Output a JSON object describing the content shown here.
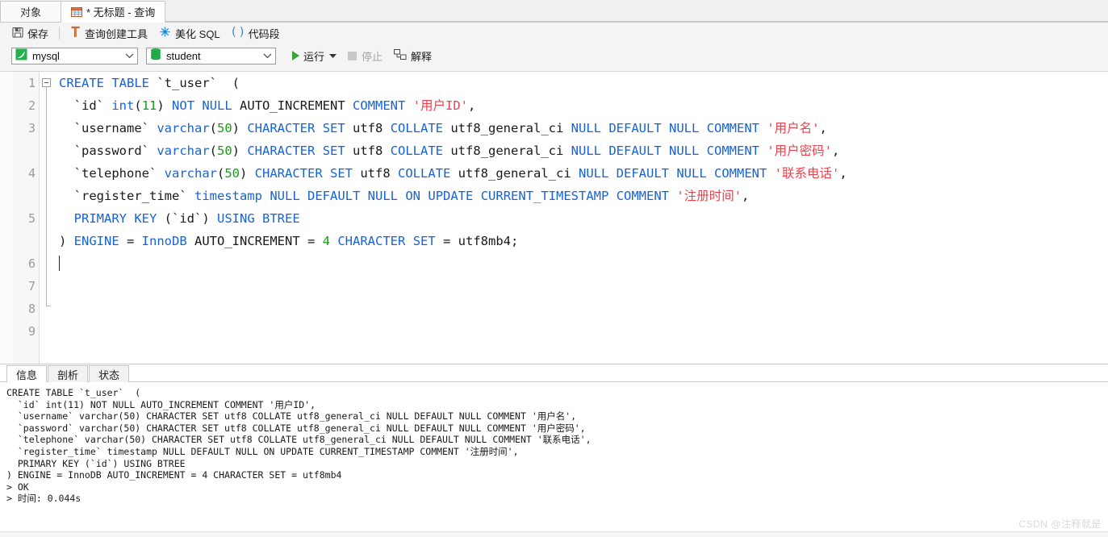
{
  "tabs": {
    "objects_label": "对象",
    "query_label": "* 无标题 - 查询",
    "query_icon": "grid-table-icon"
  },
  "toolbar": {
    "save_label": "保存",
    "save_icon": "floppy-disk-icon",
    "query_builder_label": "查询创建工具",
    "query_builder_icon": "builder-tool-icon",
    "beautify_label": "美化 SQL",
    "beautify_icon": "sparkle-wand-icon",
    "snippet_label": "代码段",
    "snippet_icon": "parentheses-icon"
  },
  "selectors": {
    "connection_value": "mysql",
    "connection_icon": "mysql-dolphin-icon",
    "database_value": "student",
    "database_icon": "database-stack-icon",
    "caret_icon": "chevron-down-icon",
    "run_label": "运行",
    "run_icon": "play-triangle-icon",
    "run_caret_icon": "chevron-down-icon",
    "stop_label": "停止",
    "stop_icon": "stop-square-icon",
    "explain_label": "解释",
    "explain_icon": "explain-plan-icon"
  },
  "editor": {
    "line_numbers": [
      "1",
      "2",
      "3",
      "4",
      "5",
      "6",
      "7",
      "8",
      "9"
    ],
    "lines": [
      {
        "n": "1",
        "tokens": [
          {
            "t": "CREATE",
            "c": "kw"
          },
          {
            "t": " ",
            "c": "plain"
          },
          {
            "t": "TABLE",
            "c": "kw"
          },
          {
            "t": " `t_user`  (",
            "c": "plain"
          }
        ]
      },
      {
        "n": "2",
        "tokens": [
          {
            "t": "  `id` ",
            "c": "plain"
          },
          {
            "t": "int",
            "c": "kw"
          },
          {
            "t": "(",
            "c": "plain"
          },
          {
            "t": "11",
            "c": "num"
          },
          {
            "t": ") ",
            "c": "plain"
          },
          {
            "t": "NOT",
            "c": "kw"
          },
          {
            "t": " ",
            "c": "plain"
          },
          {
            "t": "NULL",
            "c": "kw"
          },
          {
            "t": " AUTO_INCREMENT ",
            "c": "plain"
          },
          {
            "t": "COMMENT",
            "c": "kw"
          },
          {
            "t": " ",
            "c": "plain"
          },
          {
            "t": "'用户ID'",
            "c": "str"
          },
          {
            "t": ",",
            "c": "plain"
          }
        ]
      },
      {
        "n": "3",
        "tokens": [
          {
            "t": "  `username` ",
            "c": "plain"
          },
          {
            "t": "varchar",
            "c": "kw"
          },
          {
            "t": "(",
            "c": "plain"
          },
          {
            "t": "50",
            "c": "num"
          },
          {
            "t": ") ",
            "c": "plain"
          },
          {
            "t": "CHARACTER",
            "c": "kw"
          },
          {
            "t": " ",
            "c": "plain"
          },
          {
            "t": "SET",
            "c": "kw"
          },
          {
            "t": " utf8 ",
            "c": "plain"
          },
          {
            "t": "COLLATE",
            "c": "kw"
          },
          {
            "t": " utf8_general_ci ",
            "c": "plain"
          },
          {
            "t": "NULL",
            "c": "kw"
          },
          {
            "t": " ",
            "c": "plain"
          },
          {
            "t": "DEFAULT",
            "c": "kw"
          },
          {
            "t": " ",
            "c": "plain"
          },
          {
            "t": "NULL",
            "c": "kw"
          },
          {
            "t": " ",
            "c": "plain"
          },
          {
            "t": "COMMENT",
            "c": "kw"
          },
          {
            "t": " ",
            "c": "plain"
          },
          {
            "t": "'用户名'",
            "c": "str"
          },
          {
            "t": ",",
            "c": "plain"
          }
        ]
      },
      {
        "n": "4",
        "tokens": [
          {
            "t": "  `password` ",
            "c": "plain"
          },
          {
            "t": "varchar",
            "c": "kw"
          },
          {
            "t": "(",
            "c": "plain"
          },
          {
            "t": "50",
            "c": "num"
          },
          {
            "t": ") ",
            "c": "plain"
          },
          {
            "t": "CHARACTER",
            "c": "kw"
          },
          {
            "t": " ",
            "c": "plain"
          },
          {
            "t": "SET",
            "c": "kw"
          },
          {
            "t": " utf8 ",
            "c": "plain"
          },
          {
            "t": "COLLATE",
            "c": "kw"
          },
          {
            "t": " utf8_general_ci ",
            "c": "plain"
          },
          {
            "t": "NULL",
            "c": "kw"
          },
          {
            "t": " ",
            "c": "plain"
          },
          {
            "t": "DEFAULT",
            "c": "kw"
          },
          {
            "t": " ",
            "c": "plain"
          },
          {
            "t": "NULL",
            "c": "kw"
          },
          {
            "t": " ",
            "c": "plain"
          },
          {
            "t": "COMMENT",
            "c": "kw"
          },
          {
            "t": " ",
            "c": "plain"
          },
          {
            "t": "'用户密码'",
            "c": "str"
          },
          {
            "t": ",",
            "c": "plain"
          }
        ]
      },
      {
        "n": "5",
        "tokens": [
          {
            "t": "  `telephone` ",
            "c": "plain"
          },
          {
            "t": "varchar",
            "c": "kw"
          },
          {
            "t": "(",
            "c": "plain"
          },
          {
            "t": "50",
            "c": "num"
          },
          {
            "t": ") ",
            "c": "plain"
          },
          {
            "t": "CHARACTER",
            "c": "kw"
          },
          {
            "t": " ",
            "c": "plain"
          },
          {
            "t": "SET",
            "c": "kw"
          },
          {
            "t": " utf8 ",
            "c": "plain"
          },
          {
            "t": "COLLATE",
            "c": "kw"
          },
          {
            "t": " utf8_general_ci ",
            "c": "plain"
          },
          {
            "t": "NULL",
            "c": "kw"
          },
          {
            "t": " ",
            "c": "plain"
          },
          {
            "t": "DEFAULT",
            "c": "kw"
          },
          {
            "t": " ",
            "c": "plain"
          },
          {
            "t": "NULL",
            "c": "kw"
          },
          {
            "t": " ",
            "c": "plain"
          },
          {
            "t": "COMMENT",
            "c": "kw"
          },
          {
            "t": " ",
            "c": "plain"
          },
          {
            "t": "'联系电话'",
            "c": "str"
          },
          {
            "t": ",",
            "c": "plain"
          }
        ]
      },
      {
        "n": "6",
        "tokens": [
          {
            "t": "  `register_time` ",
            "c": "plain"
          },
          {
            "t": "timestamp",
            "c": "kw"
          },
          {
            "t": " ",
            "c": "plain"
          },
          {
            "t": "NULL",
            "c": "kw"
          },
          {
            "t": " ",
            "c": "plain"
          },
          {
            "t": "DEFAULT",
            "c": "kw"
          },
          {
            "t": " ",
            "c": "plain"
          },
          {
            "t": "NULL",
            "c": "kw"
          },
          {
            "t": " ",
            "c": "plain"
          },
          {
            "t": "ON",
            "c": "kw"
          },
          {
            "t": " ",
            "c": "plain"
          },
          {
            "t": "UPDATE",
            "c": "kw"
          },
          {
            "t": " ",
            "c": "plain"
          },
          {
            "t": "CURRENT_TIMESTAMP",
            "c": "kw"
          },
          {
            "t": " ",
            "c": "plain"
          },
          {
            "t": "COMMENT",
            "c": "kw"
          },
          {
            "t": " ",
            "c": "plain"
          },
          {
            "t": "'注册时间'",
            "c": "str"
          },
          {
            "t": ",",
            "c": "plain"
          }
        ]
      },
      {
        "n": "7",
        "tokens": [
          {
            "t": "  ",
            "c": "plain"
          },
          {
            "t": "PRIMARY",
            "c": "kw"
          },
          {
            "t": " ",
            "c": "plain"
          },
          {
            "t": "KEY",
            "c": "kw"
          },
          {
            "t": " (`id`) ",
            "c": "plain"
          },
          {
            "t": "USING",
            "c": "kw"
          },
          {
            "t": " ",
            "c": "plain"
          },
          {
            "t": "BTREE",
            "c": "kw"
          }
        ]
      },
      {
        "n": "8",
        "tokens": [
          {
            "t": ") ",
            "c": "plain"
          },
          {
            "t": "ENGINE",
            "c": "kw"
          },
          {
            "t": " = ",
            "c": "plain"
          },
          {
            "t": "InnoDB",
            "c": "kw"
          },
          {
            "t": " AUTO_INCREMENT = ",
            "c": "plain"
          },
          {
            "t": "4",
            "c": "num"
          },
          {
            "t": " ",
            "c": "plain"
          },
          {
            "t": "CHARACTER",
            "c": "kw"
          },
          {
            "t": " ",
            "c": "plain"
          },
          {
            "t": "SET",
            "c": "kw"
          },
          {
            "t": " = utf8mb4;",
            "c": "plain"
          }
        ]
      },
      {
        "n": "9",
        "tokens": []
      }
    ]
  },
  "result": {
    "tabs": [
      {
        "label": "信息",
        "active": true
      },
      {
        "label": "剖析",
        "active": false
      },
      {
        "label": "状态",
        "active": false
      }
    ],
    "output": "CREATE TABLE `t_user`  (\n  `id` int(11) NOT NULL AUTO_INCREMENT COMMENT '用户ID',\n  `username` varchar(50) CHARACTER SET utf8 COLLATE utf8_general_ci NULL DEFAULT NULL COMMENT '用户名',\n  `password` varchar(50) CHARACTER SET utf8 COLLATE utf8_general_ci NULL DEFAULT NULL COMMENT '用户密码',\n  `telephone` varchar(50) CHARACTER SET utf8 COLLATE utf8_general_ci NULL DEFAULT NULL COMMENT '联系电话',\n  `register_time` timestamp NULL DEFAULT NULL ON UPDATE CURRENT_TIMESTAMP COMMENT '注册时间',\n  PRIMARY KEY (`id`) USING BTREE\n) ENGINE = InnoDB AUTO_INCREMENT = 4 CHARACTER SET = utf8mb4\n> OK\n> 时间: 0.044s"
  },
  "watermark": {
    "text": "CSDN @注释就是"
  },
  "colors": {
    "keyword": "#1763d6",
    "number": "#14a014",
    "string": "#e8434f",
    "plain": "#1a1a1a",
    "run_green": "#3aa33a"
  }
}
